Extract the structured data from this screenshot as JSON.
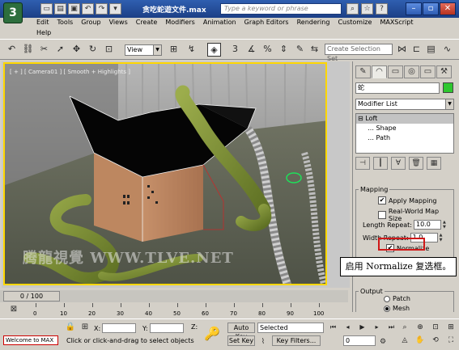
{
  "window": {
    "title": "贪吃蛇遊文件.max",
    "search_placeholder": "Type a keyword or phrase",
    "app_logo": "3",
    "qa_icons": [
      "new-file-icon",
      "open-icon",
      "save-icon",
      "undo-icon",
      "redo-icon",
      "dropdown-icon"
    ],
    "qa_glyphs": [
      "▭",
      "▤",
      "▣",
      "↶",
      "↷",
      "▾"
    ]
  },
  "menu": {
    "row1": [
      "Edit",
      "Tools",
      "Group",
      "Views",
      "Create",
      "Modifiers",
      "Animation",
      "Graph Editors",
      "Rendering",
      "Customize",
      "MAXScript"
    ],
    "row2": [
      "Help"
    ]
  },
  "toolbar": {
    "view_select": "View",
    "selection_set_placeholder": "Create Selection Set",
    "num_3": "3",
    "num_percent": "%"
  },
  "viewport": {
    "label": "[ + ] [ Camera01 ] [ Smooth + Highlights ]",
    "watermark": "腾龍視覺 WWW.TLVE.NET"
  },
  "callout": {
    "text": "启用 Normalize 复选框。"
  },
  "command_panel": {
    "tab_glyphs": [
      "✎",
      "◠",
      "▭",
      "◎",
      "▭",
      "⚒"
    ],
    "object_name": "蛇",
    "object_color": "#2ec72e",
    "modifier_list": "Modifier List",
    "stack": [
      {
        "label": "Loft",
        "level": 0,
        "selected": true
      },
      {
        "label": "Shape",
        "level": 1,
        "selected": false
      },
      {
        "label": "Path",
        "level": 1,
        "selected": false
      }
    ],
    "mapping": {
      "title": "Mapping",
      "apply_mapping": "Apply Mapping",
      "apply_mapping_checked": true,
      "real_world": "Real-World Map Size",
      "real_world_checked": false,
      "length_repeat_label": "Length Repeat:",
      "length_repeat_value": "10.0",
      "width_repeat_label": "Width Repeat:",
      "width_repeat_value": "1.0",
      "normalize": "Normalize",
      "normalize_checked": true
    },
    "output": {
      "title": "Output",
      "patch": "Patch",
      "mesh": "Mesh",
      "selected": "Mesh"
    }
  },
  "timeline": {
    "position": "0 / 100",
    "ticks": [
      "0",
      "10",
      "20",
      "30",
      "40",
      "50",
      "60",
      "70",
      "80",
      "90",
      "100"
    ]
  },
  "status": {
    "welcome": "Welcome to MAX",
    "prompt": "Click or click-and-drag to select objects",
    "x_label": "X:",
    "y_label": "Y:",
    "z_label": "Z:",
    "auto_key": "Auto Key",
    "set_key": "Set Key",
    "selected": "Selected",
    "key_filters": "Key Filters...",
    "frame": "0"
  }
}
